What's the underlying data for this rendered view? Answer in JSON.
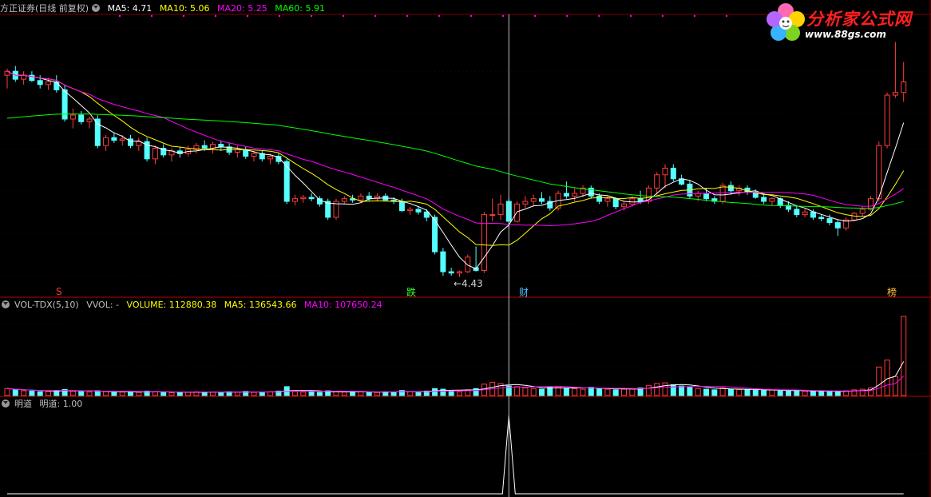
{
  "price_panel": {
    "title": "方正证券(日线 前复权)",
    "ma5": "MA5: 4.71",
    "ma10": "MA10: 5.06",
    "ma20": "MA20: 5.25",
    "ma60": "MA60: 5.91",
    "low_label": "4.43",
    "colors": {
      "ma5": "#ffffff",
      "ma10": "#ffff00",
      "ma20": "#ff00ff",
      "ma60": "#00ff00"
    }
  },
  "volume_panel": {
    "title": "VOL-TDX(5,10)",
    "vvol": "VVOL: -",
    "volume": "VOLUME: 112880.38",
    "ma5": "MA5: 136543.66",
    "ma10": "MA10: 107650.24"
  },
  "indicator_panel": {
    "name": "明道",
    "value": "明道: 1.00"
  },
  "markers": {
    "s": "S",
    "die": "跌",
    "cai": "财",
    "bang": "榜"
  },
  "logo": {
    "title": "分析家公式网",
    "url": "www.88gs.com"
  },
  "chart_data": {
    "type": "candlestick",
    "num_days": 110,
    "price_range": [
      4.35,
      6.3
    ],
    "lowest_price": 4.43,
    "candles": [
      [
        5.95,
        6.0,
        5.85,
        5.98
      ],
      [
        5.98,
        6.02,
        5.9,
        5.92
      ],
      [
        5.92,
        5.98,
        5.88,
        5.95
      ],
      [
        5.95,
        5.98,
        5.9,
        5.91
      ],
      [
        5.91,
        5.95,
        5.85,
        5.88
      ],
      [
        5.88,
        5.93,
        5.84,
        5.9
      ],
      [
        5.9,
        5.95,
        5.82,
        5.84
      ],
      [
        5.84,
        5.88,
        5.6,
        5.62
      ],
      [
        5.62,
        5.7,
        5.55,
        5.65
      ],
      [
        5.65,
        5.68,
        5.58,
        5.6
      ],
      [
        5.6,
        5.64,
        5.55,
        5.62
      ],
      [
        5.62,
        5.65,
        5.4,
        5.42
      ],
      [
        5.42,
        5.5,
        5.38,
        5.48
      ],
      [
        5.48,
        5.52,
        5.44,
        5.46
      ],
      [
        5.46,
        5.5,
        5.42,
        5.47
      ],
      [
        5.47,
        5.5,
        5.4,
        5.42
      ],
      [
        5.42,
        5.48,
        5.38,
        5.45
      ],
      [
        5.45,
        5.48,
        5.3,
        5.32
      ],
      [
        5.32,
        5.42,
        5.28,
        5.4
      ],
      [
        5.4,
        5.43,
        5.33,
        5.35
      ],
      [
        5.35,
        5.4,
        5.3,
        5.38
      ],
      [
        5.38,
        5.41,
        5.33,
        5.36
      ],
      [
        5.36,
        5.42,
        5.34,
        5.39
      ],
      [
        5.39,
        5.44,
        5.36,
        5.42
      ],
      [
        5.42,
        5.46,
        5.38,
        5.4
      ],
      [
        5.4,
        5.45,
        5.36,
        5.43
      ],
      [
        5.43,
        5.46,
        5.38,
        5.41
      ],
      [
        5.41,
        5.44,
        5.35,
        5.37
      ],
      [
        5.37,
        5.42,
        5.33,
        5.39
      ],
      [
        5.39,
        5.41,
        5.32,
        5.34
      ],
      [
        5.34,
        5.38,
        5.3,
        5.36
      ],
      [
        5.36,
        5.38,
        5.3,
        5.32
      ],
      [
        5.32,
        5.36,
        5.28,
        5.34
      ],
      [
        5.34,
        5.36,
        5.28,
        5.3
      ],
      [
        5.3,
        5.32,
        4.98,
        5.0
      ],
      [
        5.0,
        5.05,
        4.97,
        5.02
      ],
      [
        5.02,
        5.05,
        4.99,
        5.03
      ],
      [
        5.03,
        5.06,
        5.0,
        5.02
      ],
      [
        5.02,
        5.04,
        4.96,
        4.98
      ],
      [
        5.0,
        5.02,
        4.86,
        4.88
      ],
      [
        4.88,
        5.02,
        4.86,
        5.0
      ],
      [
        5.0,
        5.04,
        4.98,
        5.02
      ],
      [
        5.02,
        5.05,
        4.99,
        5.01
      ],
      [
        5.01,
        5.06,
        4.99,
        5.04
      ],
      [
        5.04,
        5.07,
        5.0,
        5.02
      ],
      [
        5.02,
        5.06,
        5.0,
        5.04
      ],
      [
        5.04,
        5.06,
        5.0,
        5.01
      ],
      [
        5.01,
        5.03,
        4.98,
        5.0
      ],
      [
        5.0,
        5.02,
        4.92,
        4.93
      ],
      [
        4.93,
        4.96,
        4.9,
        4.94
      ],
      [
        4.94,
        4.96,
        4.9,
        4.92
      ],
      [
        4.92,
        4.94,
        4.85,
        4.88
      ],
      [
        4.88,
        4.9,
        4.6,
        4.62
      ],
      [
        4.62,
        4.65,
        4.44,
        4.47
      ],
      [
        4.47,
        4.5,
        4.44,
        4.46
      ],
      [
        4.46,
        4.48,
        4.43,
        4.47
      ],
      [
        4.47,
        4.6,
        4.46,
        4.58
      ],
      [
        4.5,
        4.66,
        4.47,
        4.48
      ],
      [
        4.48,
        4.92,
        4.46,
        4.9
      ],
      [
        4.9,
        5.02,
        4.85,
        4.9
      ],
      [
        4.9,
        5.05,
        4.86,
        4.98
      ],
      [
        5.0,
        5.03,
        4.8,
        4.85
      ],
      [
        4.85,
        5.0,
        4.84,
        4.98
      ],
      [
        4.98,
        5.04,
        4.95,
        5.0
      ],
      [
        5.0,
        5.05,
        4.96,
        5.02
      ],
      [
        5.02,
        5.07,
        4.98,
        5.0
      ],
      [
        5.0,
        5.04,
        4.93,
        4.95
      ],
      [
        4.95,
        5.08,
        4.93,
        5.06
      ],
      [
        5.06,
        5.15,
        5.02,
        5.04
      ],
      [
        5.04,
        5.1,
        5.0,
        5.06
      ],
      [
        5.06,
        5.12,
        5.03,
        5.1
      ],
      [
        5.1,
        5.12,
        5.02,
        5.04
      ],
      [
        5.04,
        5.06,
        4.98,
        5.0
      ],
      [
        5.0,
        5.04,
        4.96,
        5.02
      ],
      [
        5.02,
        5.03,
        4.94,
        4.96
      ],
      [
        4.96,
        5.0,
        4.93,
        4.98
      ],
      [
        4.98,
        5.04,
        4.96,
        5.02
      ],
      [
        5.02,
        5.08,
        4.98,
        5.0
      ],
      [
        5.0,
        5.12,
        4.98,
        5.1
      ],
      [
        5.1,
        5.22,
        5.05,
        5.2
      ],
      [
        5.2,
        5.28,
        5.1,
        5.25
      ],
      [
        5.25,
        5.28,
        5.15,
        5.17
      ],
      [
        5.17,
        5.2,
        5.12,
        5.13
      ],
      [
        5.13,
        5.16,
        5.02,
        5.04
      ],
      [
        5.04,
        5.08,
        5.0,
        5.06
      ],
      [
        5.06,
        5.1,
        5.0,
        5.02
      ],
      [
        5.02,
        5.04,
        4.98,
        5.0
      ],
      [
        5.0,
        5.14,
        4.98,
        5.12
      ],
      [
        5.12,
        5.15,
        5.05,
        5.08
      ],
      [
        5.08,
        5.12,
        5.04,
        5.1
      ],
      [
        5.1,
        5.12,
        5.05,
        5.07
      ],
      [
        5.07,
        5.09,
        5.02,
        5.03
      ],
      [
        5.03,
        5.06,
        4.98,
        5.0
      ],
      [
        5.0,
        5.03,
        4.97,
        5.02
      ],
      [
        5.02,
        5.03,
        4.95,
        4.97
      ],
      [
        4.97,
        5.0,
        4.92,
        4.94
      ],
      [
        4.94,
        4.97,
        4.88,
        4.9
      ],
      [
        4.9,
        4.95,
        4.88,
        4.92
      ],
      [
        4.92,
        4.94,
        4.86,
        4.88
      ],
      [
        4.88,
        4.9,
        4.85,
        4.87
      ],
      [
        4.87,
        4.9,
        4.82,
        4.84
      ],
      [
        4.84,
        4.86,
        4.74,
        4.8
      ],
      [
        4.8,
        4.88,
        4.78,
        4.86
      ],
      [
        4.86,
        4.92,
        4.85,
        4.91
      ],
      [
        4.91,
        4.96,
        4.89,
        4.94
      ],
      [
        4.94,
        5.04,
        4.93,
        5.02
      ],
      [
        5.02,
        5.45,
        5.0,
        5.42
      ],
      [
        5.42,
        5.82,
        5.4,
        5.8
      ],
      [
        5.8,
        6.2,
        5.78,
        5.82
      ],
      [
        5.82,
        6.05,
        5.75,
        5.9
      ]
    ],
    "volume_max": 260000,
    "volumes": [
      22000,
      18000,
      15000,
      14000,
      12000,
      13000,
      16000,
      19000,
      14000,
      12000,
      11000,
      15000,
      13000,
      10000,
      11000,
      12000,
      10000,
      14000,
      12000,
      10000,
      9000,
      10000,
      11000,
      12000,
      10000,
      11000,
      10000,
      12000,
      11000,
      13000,
      10000,
      11000,
      12000,
      14000,
      28000,
      13000,
      11000,
      12000,
      10000,
      15000,
      13000,
      11000,
      10000,
      12000,
      11000,
      10000,
      12000,
      11000,
      16000,
      12000,
      11000,
      14000,
      22000,
      20000,
      16000,
      12000,
      18000,
      22000,
      36000,
      42000,
      38000,
      30000,
      28000,
      24000,
      22000,
      20000,
      26000,
      28000,
      24000,
      22000,
      20000,
      26000,
      22000,
      20000,
      18000,
      20000,
      22000,
      24000,
      32000,
      38000,
      40000,
      34000,
      30000,
      26000,
      22000,
      20000,
      18000,
      24000,
      20000,
      19000,
      18000,
      17000,
      16000,
      18000,
      15000,
      14000,
      16000,
      14000,
      13000,
      12000,
      14000,
      12000,
      15000,
      18000,
      20000,
      24000,
      90000,
      112000,
      60000,
      250000
    ],
    "indicator": {
      "spike_day": 61,
      "value": 1.0
    },
    "crosshair_day": 61
  }
}
